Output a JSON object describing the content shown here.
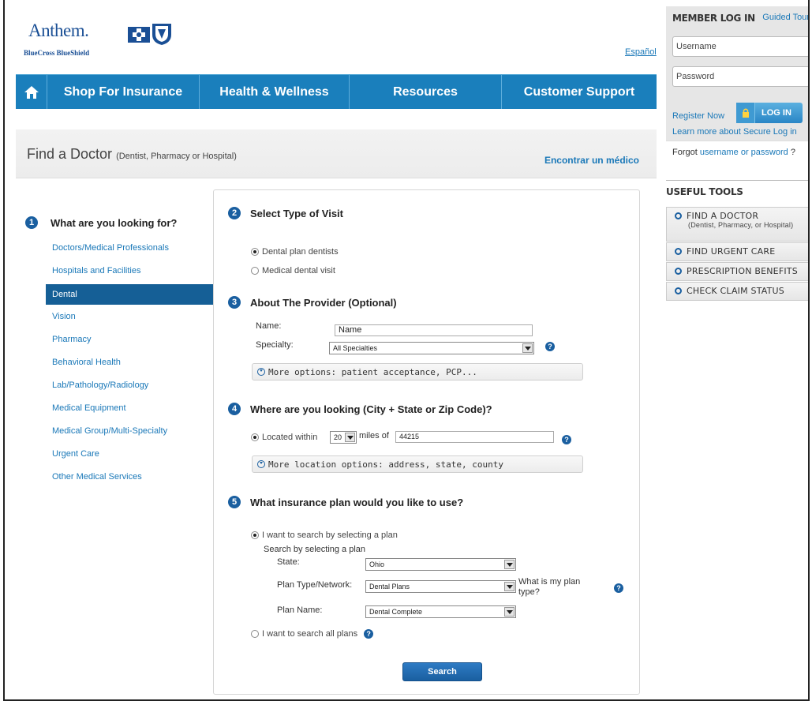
{
  "header": {
    "brand_name": "Anthem.",
    "brand_sub": "BlueCross BlueShield",
    "language_link": "Español"
  },
  "nav": {
    "items": [
      {
        "label": "Shop For Insurance"
      },
      {
        "label": "Health & Wellness"
      },
      {
        "label": "Resources"
      },
      {
        "label": "Customer Support"
      }
    ],
    "color": "#1a7fbc"
  },
  "page": {
    "title": "Find a Doctor",
    "title_sub": "(Dentist, Pharmacy or Hospital)",
    "alt_language_link": "Encontrar un médico"
  },
  "step1": {
    "number": "1",
    "label": "What are you looking for?",
    "categories": [
      "Doctors/Medical Professionals",
      "Hospitals and Facilities",
      "Dental",
      "Vision",
      "Pharmacy",
      "Behavioral Health",
      "Lab/Pathology/Radiology",
      "Medical Equipment",
      "Medical Group/Multi-Specialty",
      "Urgent Care",
      "Other Medical Services"
    ],
    "selected": "Dental"
  },
  "step2": {
    "number": "2",
    "label": "Select Type of Visit",
    "options": [
      "Dental plan dentists",
      "Medical dental visit"
    ],
    "selected": "Dental plan dentists"
  },
  "step3": {
    "number": "3",
    "label": "About The Provider (Optional)",
    "name_label": "Name:",
    "name_value": "Name",
    "specialty_label": "Specialty:",
    "specialty_value": "All Specialties",
    "more_options": "More options: patient acceptance, PCP..."
  },
  "step4": {
    "number": "4",
    "label": "Where are you looking (City + State or Zip Code)?",
    "located_within": "Located within",
    "miles_value": "20",
    "miles_of": "miles of",
    "zip_value": "44215",
    "more_location": "More location options: address, state, county"
  },
  "step5": {
    "number": "5",
    "label": "What insurance plan would you like to use?",
    "option_select_plan": "I want to search by selecting a plan",
    "search_by_label": "Search by selecting a plan",
    "state_label": "State:",
    "state_value": "Ohio",
    "plan_type_label": "Plan Type/Network:",
    "plan_type_value": "Dental Plans",
    "what_is_plan_type": "What is my plan type?",
    "plan_name_label": "Plan Name:",
    "plan_name_value": "Dental Complete",
    "option_all_plans": "I want to search all plans",
    "search_button": "Search"
  },
  "login": {
    "heading": "MEMBER LOG IN",
    "guided_tour": "Guided Tour",
    "username_placeholder": "Username",
    "password_placeholder": "Password",
    "register": "Register Now",
    "login_button": "LOG IN",
    "learn_more": "Learn more about Secure Log in",
    "forgot_prefix": "Forgot",
    "forgot_link": "username or password",
    "forgot_suffix": "?"
  },
  "tools": {
    "heading": "USEFUL TOOLS",
    "items": [
      {
        "label": "FIND A DOCTOR",
        "sub": "(Dentist, Pharmacy, or Hospital)"
      },
      {
        "label": "FIND URGENT CARE"
      },
      {
        "label": "PRESCRIPTION BENEFITS"
      },
      {
        "label": "CHECK CLAIM STATUS"
      }
    ]
  },
  "colors": {
    "brand_blue": "#1a4f95",
    "link_blue": "#1a78b8",
    "active_blue": "#155f96"
  },
  "icons": [
    "home-icon",
    "blue-cross-icon",
    "blue-shield-icon",
    "help-icon",
    "lock-icon",
    "expand-circle-icon",
    "dropdown-arrow-icon"
  ]
}
